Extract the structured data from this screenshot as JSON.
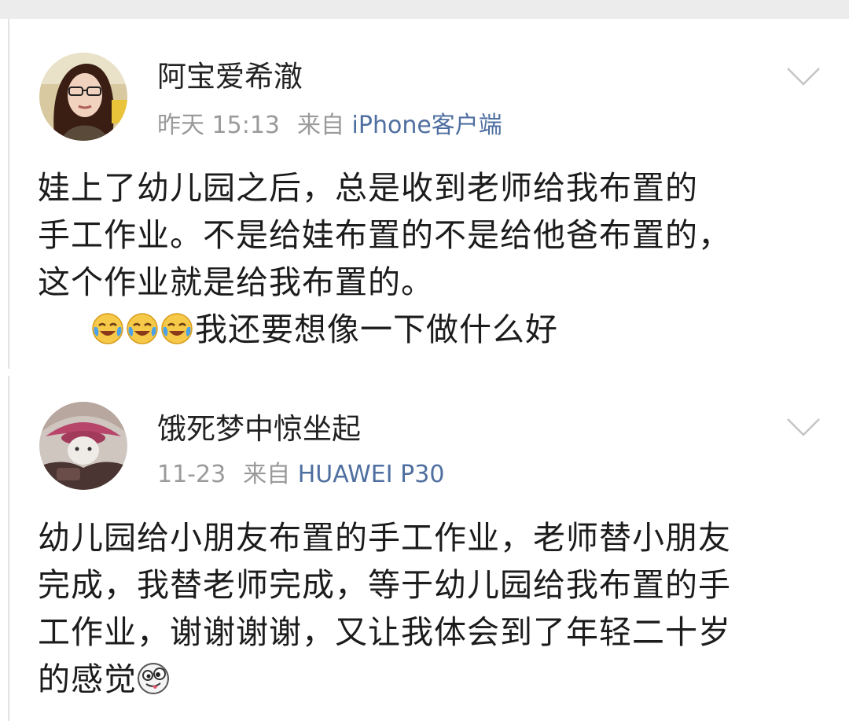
{
  "posts": [
    {
      "username": "阿宝爱希澈",
      "time": "昨天 15:13",
      "from_label": "来自",
      "source": "iPhone客户端",
      "lines": [
        "娃上了幼儿园之后，总是收到老师给我布置的",
        "手工作业。不是给娃布置的不是给他爸布置的，",
        "这个作业就是给我布置的。"
      ],
      "emoji_line_text": "我还要想像一下做什么好",
      "emojis": [
        "laugh-cry-emoji",
        "laugh-cry-emoji",
        "laugh-cry-emoji"
      ]
    },
    {
      "username": "饿死梦中惊坐起",
      "time": "11-23",
      "from_label": "来自",
      "source": "HUAWEI P30",
      "lines": [
        "幼儿园给小朋友布置的手工作业，老师替小朋友",
        "完成，我替老师完成，等于幼儿园给我布置的手",
        "工作业，谢谢谢谢，又让我体会到了年轻二十岁"
      ],
      "last_line_text": "的感觉",
      "emojis": [
        "silly-face-emoji"
      ]
    }
  ],
  "colors": {
    "source_link": "#4f6fa0",
    "meta_gray": "#9a9a9a",
    "text": "#1c1c1c"
  }
}
